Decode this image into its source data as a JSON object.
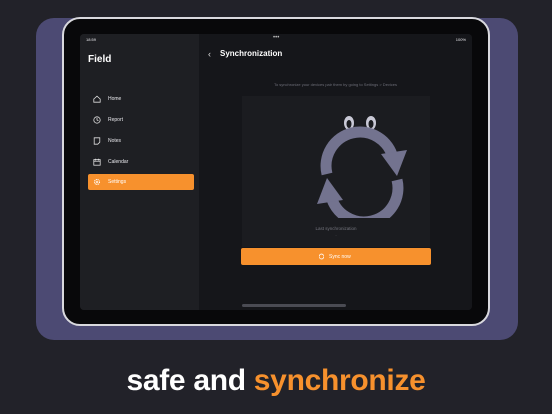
{
  "status_bar": {
    "time": "18:59",
    "battery": "100%",
    "dots": "•••"
  },
  "sidebar": {
    "title": "Field",
    "items": [
      {
        "label": "Home",
        "icon": "home-icon",
        "active": false
      },
      {
        "label": "Report",
        "icon": "clock-icon",
        "active": false
      },
      {
        "label": "Notes",
        "icon": "note-icon",
        "active": false
      },
      {
        "label": "Calendar",
        "icon": "calendar-icon",
        "active": false
      },
      {
        "label": "Settings",
        "icon": "gear-icon",
        "active": true
      }
    ]
  },
  "main": {
    "back_icon": "‹",
    "title": "Synchronization",
    "hint": "To synchronize your devices pair them by going to Settings > Devices",
    "last_sync_label": "Last synchronization",
    "last_sync_value": "-",
    "sync_button_label": "Sync now"
  },
  "tagline": {
    "part1": "safe and ",
    "part2": "synchronize"
  },
  "colors": {
    "accent": "#f7912d",
    "backdrop": "#4c4a73",
    "background": "#222229",
    "graphic": "#73738f"
  }
}
